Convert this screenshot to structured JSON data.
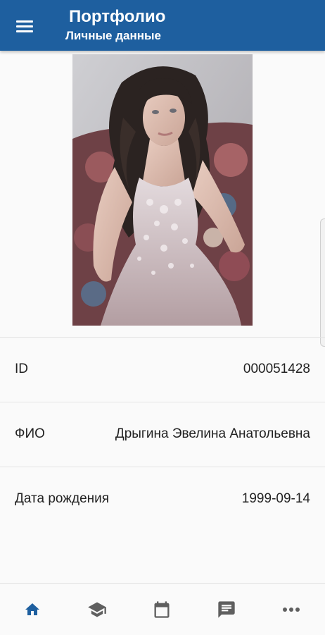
{
  "app_bar": {
    "title": "Портфолио",
    "subtitle": "Личные данные",
    "menu_icon": "menu-icon"
  },
  "profile": {
    "photo_icon": "profile-photo",
    "fields": [
      {
        "label": "ID",
        "value": "000051428"
      },
      {
        "label": "ФИО",
        "value": "Дрыгина Эвелина Анатольевна"
      },
      {
        "label": "Дата рождения",
        "value": "1999-09-14"
      }
    ]
  },
  "bottom_nav": {
    "items": [
      {
        "icon": "home-icon",
        "active": true
      },
      {
        "icon": "graduation-cap-icon",
        "active": false
      },
      {
        "icon": "calendar-icon",
        "active": false
      },
      {
        "icon": "chat-icon",
        "active": false
      },
      {
        "icon": "more-icon",
        "active": false
      }
    ]
  },
  "colors": {
    "primary": "#1e5f9f",
    "active_nav": "#1e5f9f",
    "inactive_nav": "#5f5f5f",
    "background": "#fafafa",
    "divider": "#e4e4e4"
  }
}
